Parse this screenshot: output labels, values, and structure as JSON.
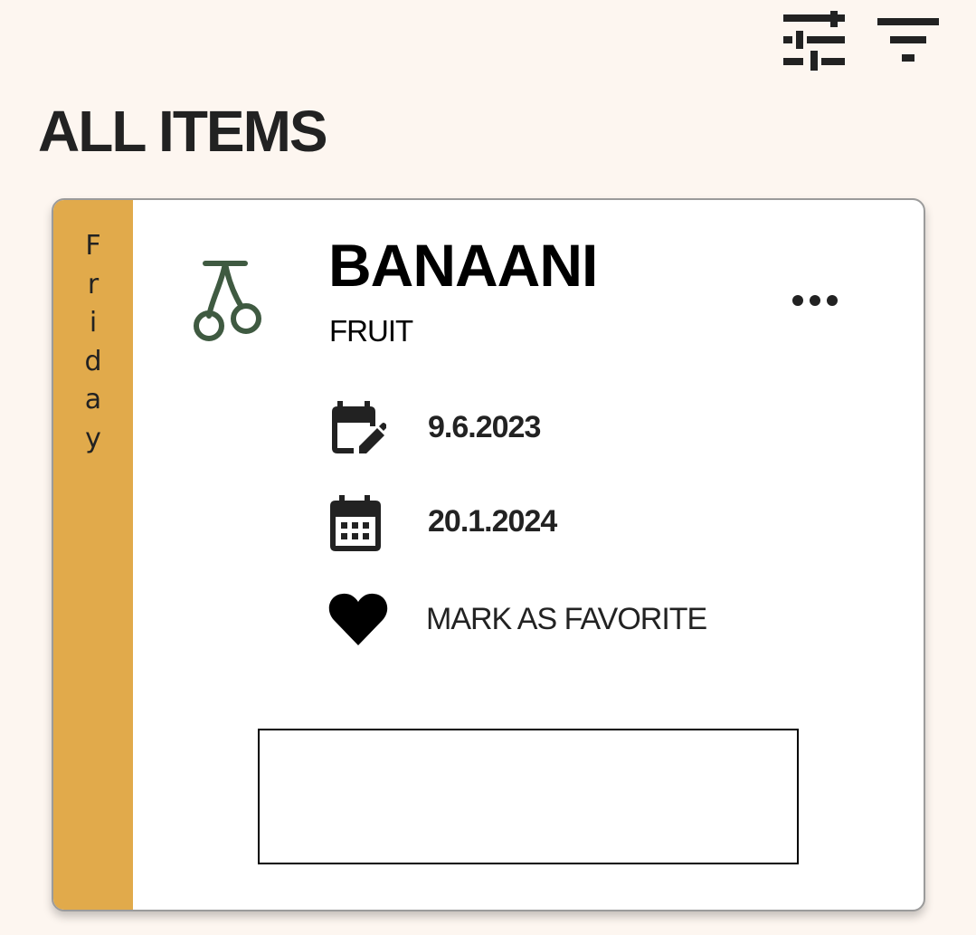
{
  "header": {
    "title": "ALL ITEMS",
    "icons": {
      "tune": "tune-sliders-icon",
      "filter": "filter-list-icon"
    }
  },
  "card": {
    "day": "Friday",
    "day_color": "#e1aa4b",
    "name": "BANAANI",
    "category": "FRUIT",
    "category_icon": "cherries-icon",
    "category_icon_color": "#3f5a41",
    "edited_date": "9.6.2023",
    "expiry_date": "20.1.2024",
    "favorite_label": "MARK AS FAVORITE",
    "more_icon": "more-horizontal-icon",
    "box_text": ""
  }
}
